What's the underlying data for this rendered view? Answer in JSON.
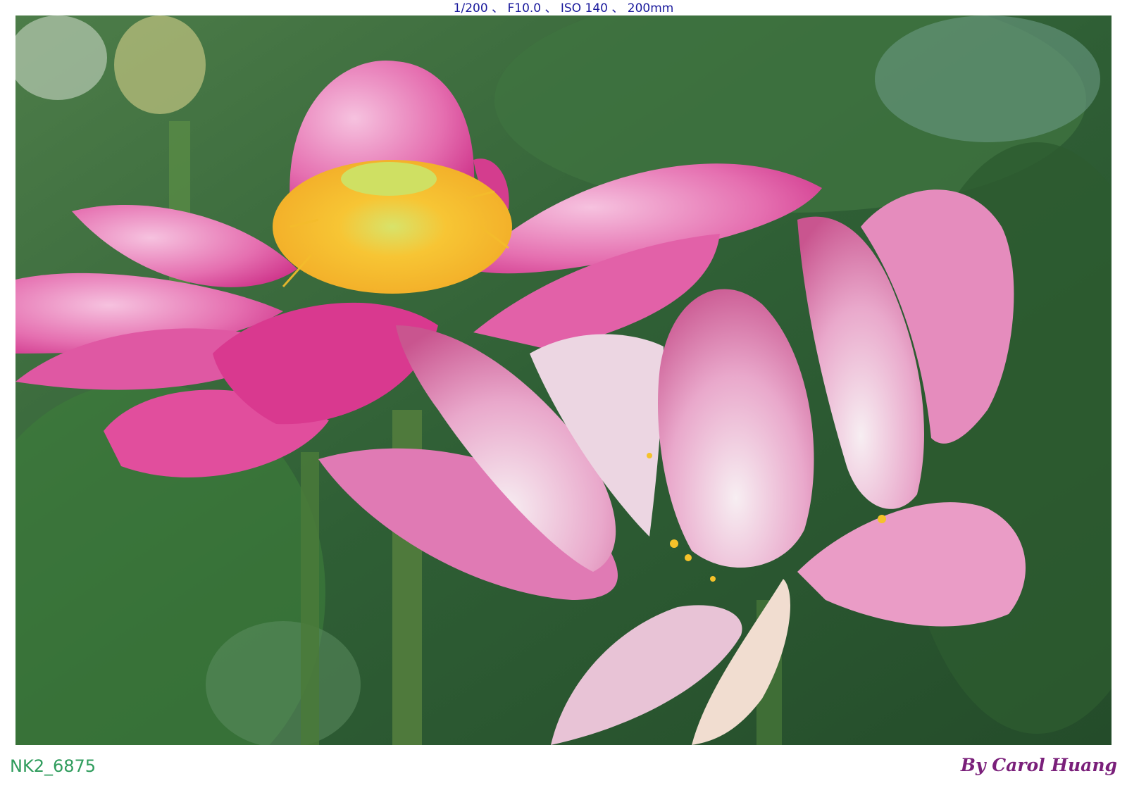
{
  "exif_info": "1/200 、 F10.0 、 ISO 140 、 200mm",
  "photo": {
    "subject": "pink lotus flowers",
    "colors": {
      "petal_pink": "#e34fa0",
      "petal_light": "#f2b3d6",
      "stamen_yellow": "#f5c22a",
      "leaf_green": "#3c7a3a"
    }
  },
  "filename": "NK2_6875",
  "signature": "By Carol Huang"
}
